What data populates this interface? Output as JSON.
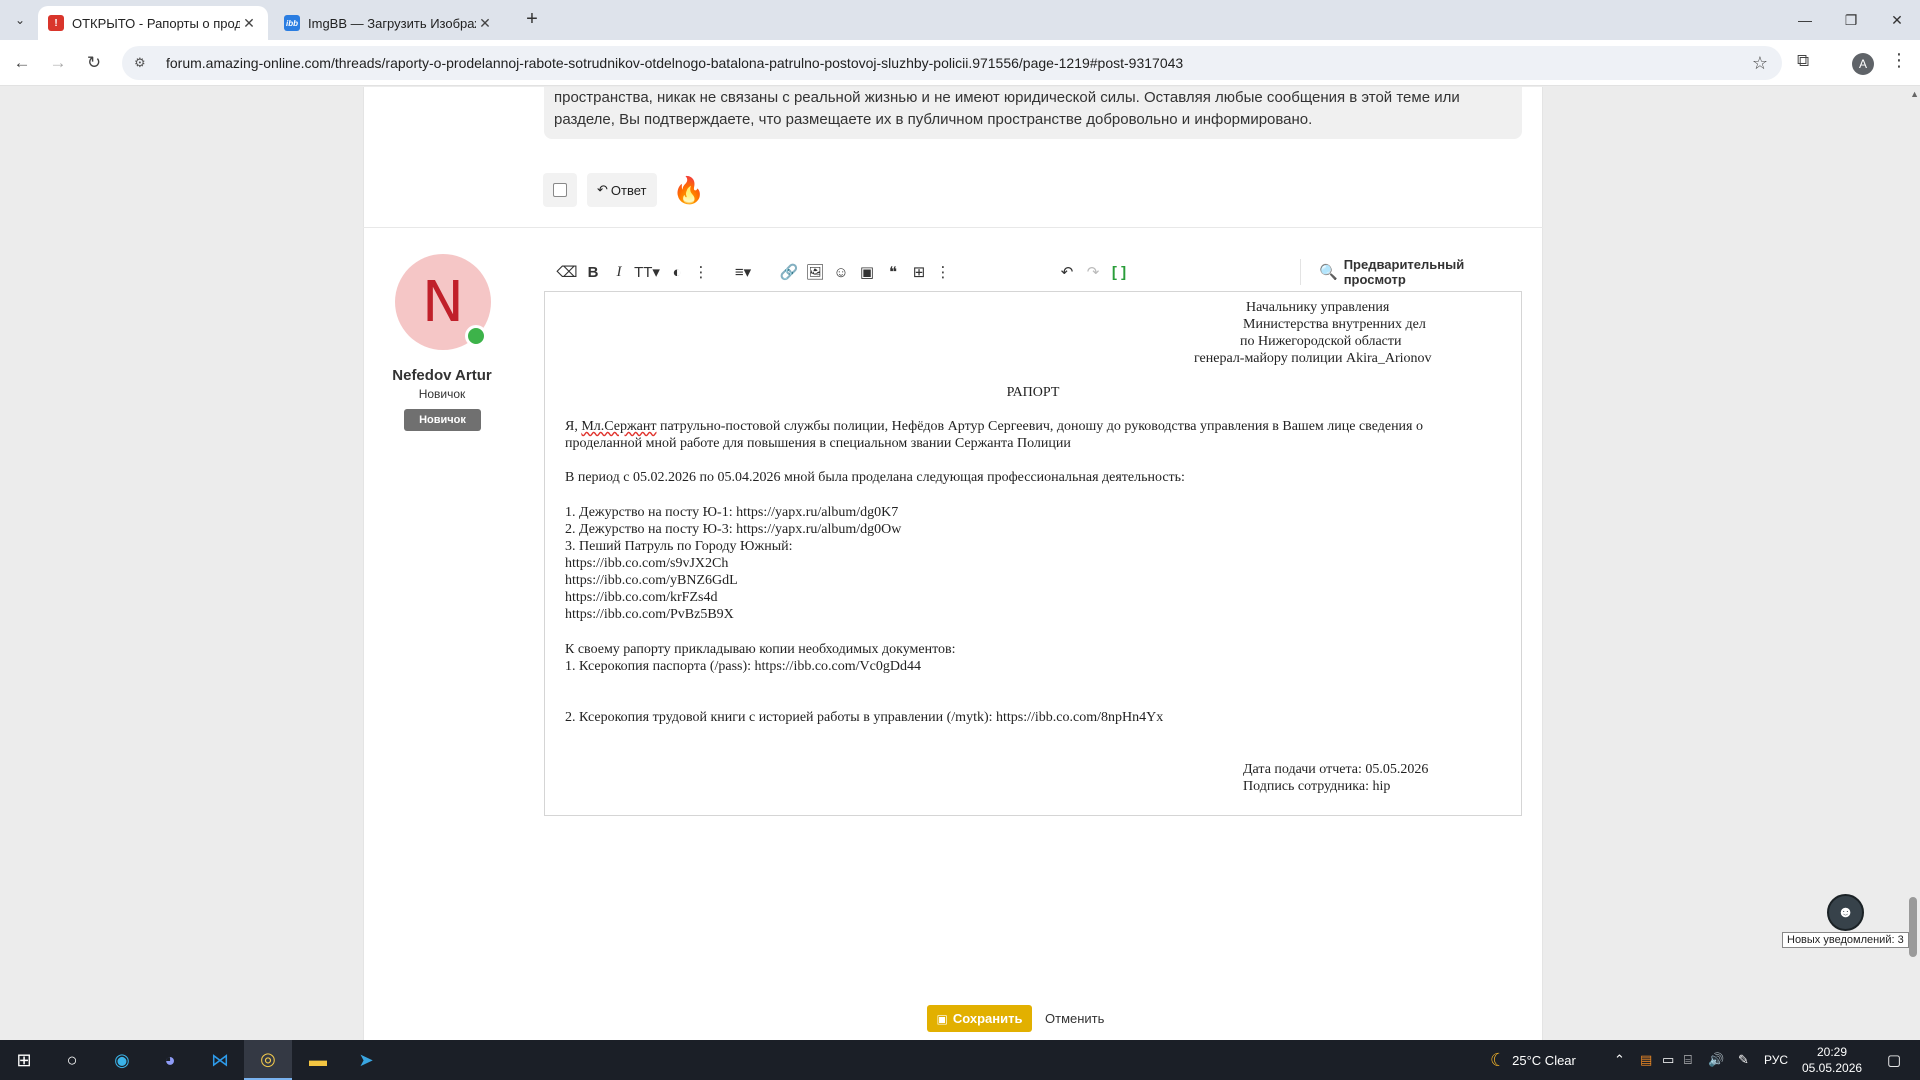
{
  "browser": {
    "tabs": [
      {
        "title": "ОТКРЫТО - Рапорты о проделанной работе",
        "favicon_color": "#d9352b",
        "favicon_glyph": "⚠"
      },
      {
        "title": "ImgBB — Загрузить Изображение",
        "favicon_color": "#2a7de1",
        "favicon_glyph": "ibb"
      }
    ],
    "url": "forum.amazing-online.com/threads/raporty-o-prodelannoj-rabote-sotrudnikov-otdelnogo-batalona-patrulno-postovoj-sluzhby-policii.971556/page-1219#post-9317043",
    "profile_initial": "A"
  },
  "page": {
    "notice_lines": [
      "пространства, никак не связаны с реальной жизнью и не имеют юридической силы. Оставляя любые сообщения в этой теме или",
      "разделе, Вы подтверждаете, что размещаете их в публичном пространстве добровольно и информировано."
    ],
    "reply_label": "Ответ",
    "reaction_icon": "fire",
    "user": {
      "initial": "N",
      "name": "Nefedov Artur",
      "title": "Новичок",
      "banner": "Новичок",
      "avatar_bg": "#f5c6c6",
      "avatar_fg": "#c0202a",
      "online_color": "#3db34a"
    },
    "editor": {
      "preview_label": "Предварительный просмотр",
      "lines": {
        "addr1": "Начальнику управления",
        "addr2": "Министерства внутренних дел",
        "addr3": "по Нижегородской области",
        "addr4": "генерал-майору полиции Akira_Arionov",
        "heading": "РАПОРТ",
        "intro_a": "Я, ",
        "intro_misspelled": "Мл.Сержант",
        "intro_b": " патрульно-постовой службы полиции, Нефёдов Артур Сергеевич, доношу до руководства управления в Вашем лице сведения о",
        "intro2": "проделанной мной работе для повышения в специальном звании Сержанта Полиции",
        "period": "В период с 05.02.2026 по 05.04.2026 мной была проделана следующая профессиональная деятельность:",
        "item1": "1. Дежурство на посту Ю-1: https://yapx.ru/album/dg0K7",
        "item2": "2. Дежурство на посту Ю-3: https://yapx.ru/album/dg0Ow",
        "item3": "3. Пеший Патруль по Городу Южный:",
        "link1": "https://ibb.co.com/s9vJX2Ch",
        "link2": "https://ibb.co.com/yBNZ6GdL",
        "link3": "https://ibb.co.com/krFZs4d",
        "link4": "https://ibb.co.com/PvBz5B9X",
        "attach": "К своему рапорту прикладываю копии необходимых документов:",
        "doc1": "1. Ксерокопия паспорта (/pass):  https://ibb.co.com/Vc0gDd44",
        "doc2": "2. Ксерокопия трудовой книги с историей работы в управлении (/mytk):  https://ibb.co.com/8npHn4Yx",
        "date": "Дата подачи отчета: 05.05.2026",
        "sign": "Подпись сотрудника: hip"
      }
    },
    "save_label": "Сохранить",
    "cancel_label": "Отменить",
    "accent_color": "#e2b000",
    "notification_tooltip": "Новых уведомлений: 3"
  },
  "taskbar": {
    "weather": "25°C  Clear",
    "language": "РУС",
    "time": "20:29",
    "date": "05.05.2026"
  }
}
